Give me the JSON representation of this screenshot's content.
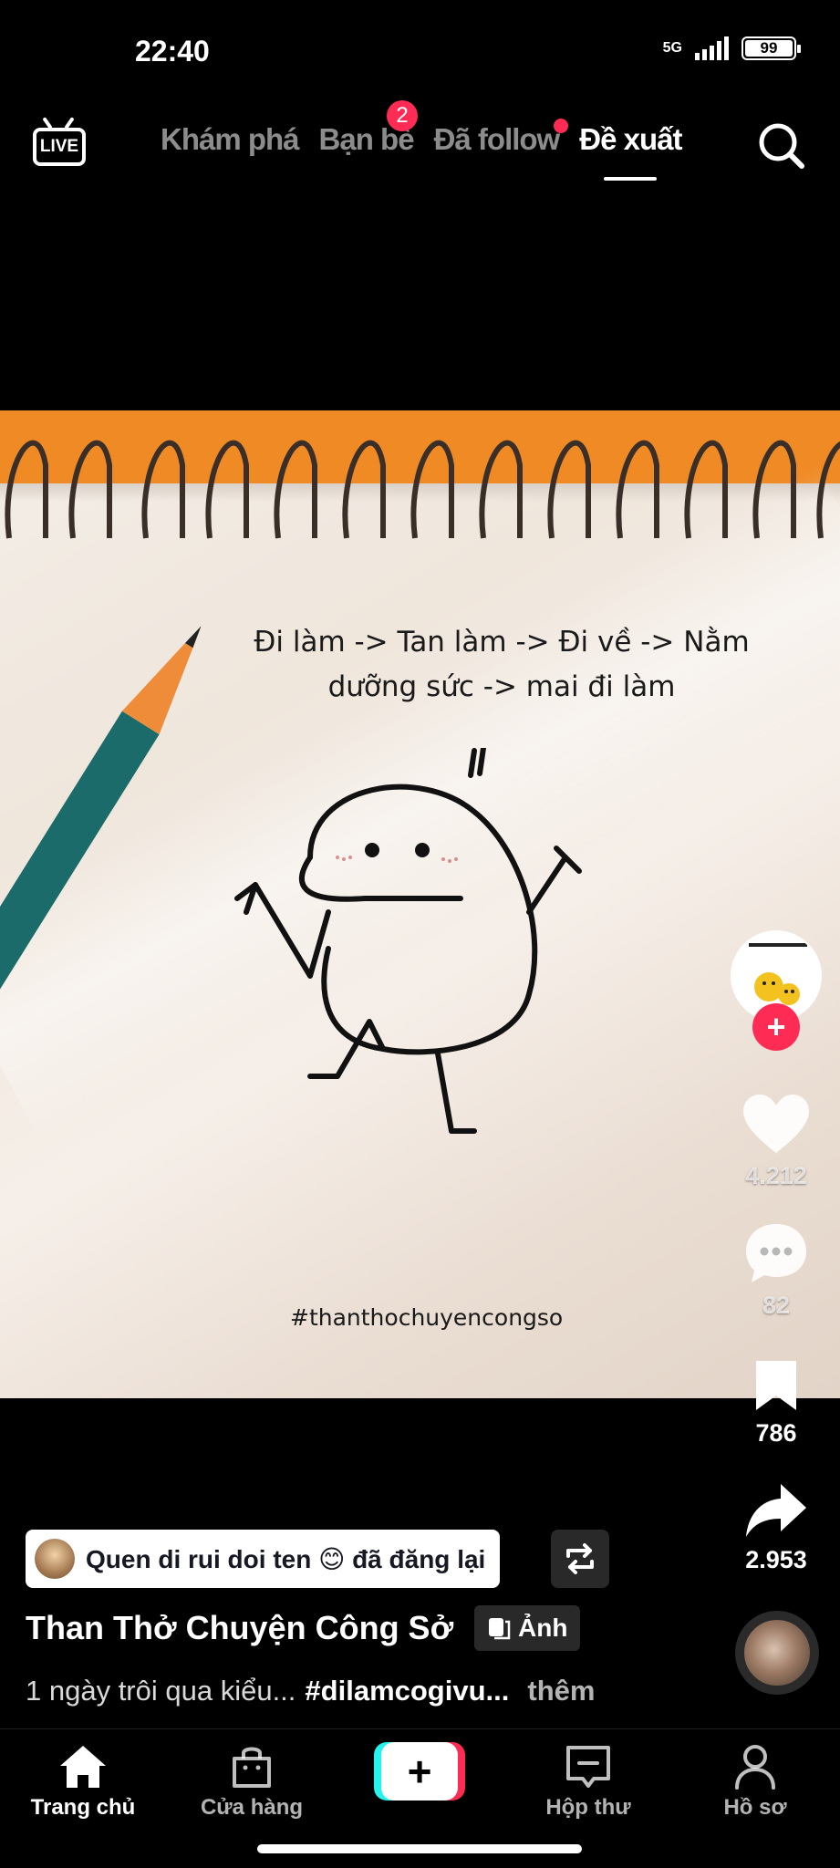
{
  "status": {
    "time": "22:40",
    "network": "5G",
    "battery": "99"
  },
  "nav": {
    "live_label": "LIVE",
    "tabs": [
      {
        "label": "Khám phá"
      },
      {
        "label": "Bạn bè",
        "badge": "2"
      },
      {
        "label": "Đã follow",
        "dot": true
      },
      {
        "label": "Đề xuất",
        "active": true
      }
    ]
  },
  "video": {
    "caption": "Đi làm -> Tan làm -> Đi về -> Nằm dưỡng sức -> mai đi làm",
    "hashtag": "#thanthochuyencongso"
  },
  "rail": {
    "likes": "4.212",
    "comments": "82",
    "saves": "786",
    "shares": "2.953"
  },
  "post": {
    "repost_text": "Quen di rui doi ten 😊 đã đăng lại",
    "author": "Than Thở Chuyện Công Sở",
    "photo_tag": "Ảnh",
    "desc_text": "1 ngày trôi qua kiểu...",
    "desc_hashtag": "#dilamcogivu...",
    "more": "thêm"
  },
  "tabbar": {
    "home": "Trang chủ",
    "shop": "Cửa hàng",
    "inbox": "Hộp thư",
    "profile": "Hồ sơ"
  },
  "colors": {
    "accent": "#fe2c55",
    "cyan": "#25f4ee",
    "orange": "#f08a24"
  }
}
